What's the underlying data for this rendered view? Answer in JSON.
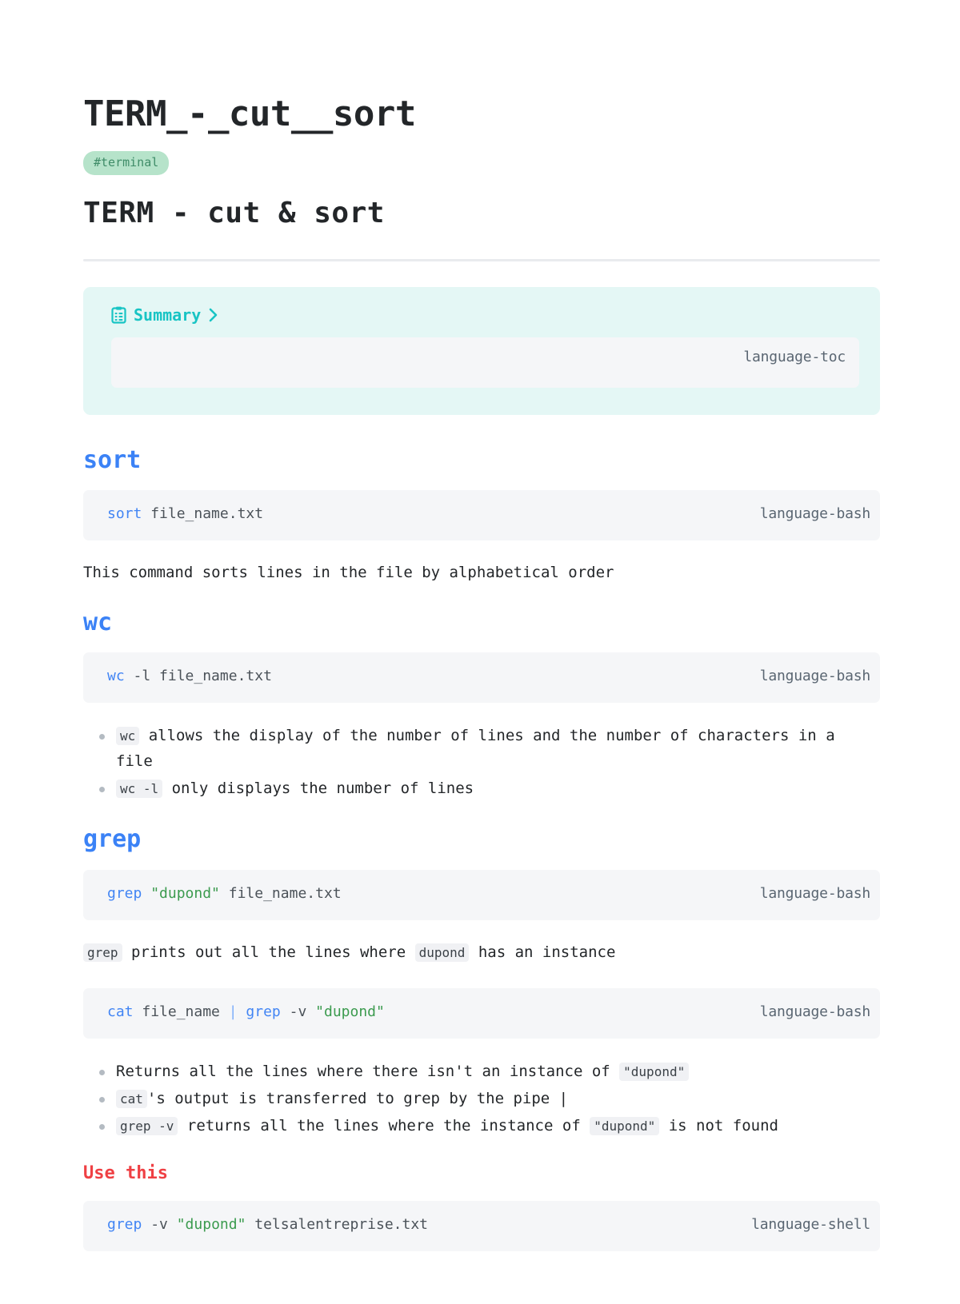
{
  "document": {
    "title": "TERM_-_cut__sort",
    "tag": "#terminal",
    "heading": "TERM - cut & sort"
  },
  "summary": {
    "icon": "clipboard-list-icon",
    "label": "Summary",
    "chevron": "chevron-right-icon",
    "code_language": "language-toc",
    "code_text": ""
  },
  "sections": [
    {
      "heading": "sort",
      "heading_color": "#3b82f6",
      "code": {
        "language": "language-bash",
        "tokens": [
          {
            "text": "sort",
            "type": "keyword"
          },
          {
            "text": " file_name.txt",
            "type": "plain"
          }
        ]
      },
      "paragraph": "This command sorts lines in the file by alphabetical order"
    },
    {
      "heading": "wc",
      "heading_color": "#3b82f6",
      "code": {
        "language": "language-bash",
        "tokens": [
          {
            "text": "wc",
            "type": "keyword"
          },
          {
            "text": " -l file_name.txt",
            "type": "plain"
          }
        ]
      },
      "bullets": [
        [
          {
            "text": "wc",
            "type": "code"
          },
          {
            "text": " allows the display of the number of lines and the number of characters in a file",
            "type": "text"
          }
        ],
        [
          {
            "text": "wc -l",
            "type": "code"
          },
          {
            "text": " only displays the number of lines",
            "type": "text"
          }
        ]
      ]
    },
    {
      "heading": "grep",
      "heading_color": "#3b82f6",
      "code": {
        "language": "language-bash",
        "tokens": [
          {
            "text": "grep",
            "type": "keyword"
          },
          {
            "text": " ",
            "type": "plain"
          },
          {
            "text": "\"dupond\"",
            "type": "string"
          },
          {
            "text": " file_name.txt",
            "type": "plain"
          }
        ]
      },
      "paragraph_parts": [
        {
          "text": "grep",
          "type": "code"
        },
        {
          "text": " prints out all the lines where ",
          "type": "text"
        },
        {
          "text": "dupond",
          "type": "code"
        },
        {
          "text": " has an instance",
          "type": "text"
        }
      ],
      "code2": {
        "language": "language-bash",
        "tokens": [
          {
            "text": "cat",
            "type": "keyword"
          },
          {
            "text": " file_name ",
            "type": "plain"
          },
          {
            "text": "|",
            "type": "pipe"
          },
          {
            "text": " ",
            "type": "plain"
          },
          {
            "text": "grep",
            "type": "keyword"
          },
          {
            "text": " -v ",
            "type": "plain"
          },
          {
            "text": "\"dupond\"",
            "type": "string"
          }
        ]
      },
      "bullets": [
        [
          {
            "text": "Returns all the lines where there isn't an instance of ",
            "type": "text"
          },
          {
            "text": "\"dupond\"",
            "type": "code"
          }
        ],
        [
          {
            "text": "cat",
            "type": "code"
          },
          {
            "text": "'s output is transferred to grep by the pipe |",
            "type": "text"
          }
        ],
        [
          {
            "text": "grep -v",
            "type": "code"
          },
          {
            "text": " returns all the lines where the instance of ",
            "type": "text"
          },
          {
            "text": "\"dupond\"",
            "type": "code"
          },
          {
            "text": " is not found",
            "type": "text"
          }
        ]
      ]
    },
    {
      "heading": "Use this",
      "heading_color": "#ef4044",
      "code": {
        "language": "language-shell",
        "tokens": [
          {
            "text": "grep",
            "type": "keyword"
          },
          {
            "text": " -v ",
            "type": "plain"
          },
          {
            "text": "\"dupond\"",
            "type": "string"
          },
          {
            "text": " telsalentreprise.txt",
            "type": "plain"
          }
        ]
      }
    }
  ],
  "colors": {
    "accent_blue": "#3b82f6",
    "accent_red": "#ef4044",
    "accent_teal": "#18c4c4",
    "tag_bg": "#b6e3ca",
    "tag_fg": "#3f8c68",
    "callout_bg": "#e4f7f5",
    "code_bg": "#f5f6f8",
    "string_green": "#3c9b4f"
  }
}
